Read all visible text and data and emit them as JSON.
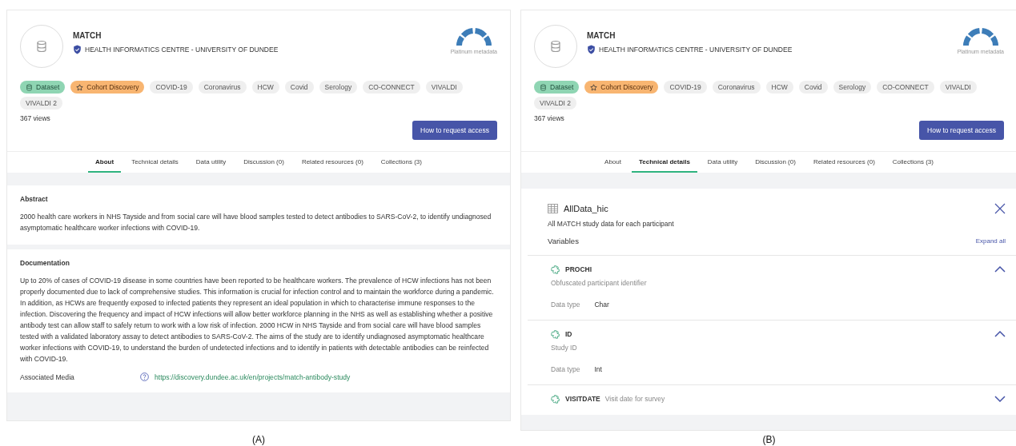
{
  "panels": [
    {
      "caption": "(A)",
      "title": "MATCH",
      "publisher": "HEALTH INFORMATICS CENTRE - UNIVERSITY OF DUNDEE",
      "metadata_badge": "Platinum metadata",
      "tags": [
        {
          "label": "Dataset",
          "kind": "dataset"
        },
        {
          "label": "Cohort Discovery",
          "kind": "cohort"
        },
        {
          "label": "COVID-19",
          "kind": "keyword"
        },
        {
          "label": "Coronavirus",
          "kind": "keyword"
        },
        {
          "label": "HCW",
          "kind": "keyword"
        },
        {
          "label": "Covid",
          "kind": "keyword"
        },
        {
          "label": "Serology",
          "kind": "keyword"
        },
        {
          "label": "CO-CONNECT",
          "kind": "keyword"
        },
        {
          "label": "VIVALDI",
          "kind": "keyword"
        },
        {
          "label": "VIVALDI 2",
          "kind": "keyword"
        }
      ],
      "views": "367 views",
      "request_button": "How to request access",
      "tabs": [
        {
          "label": "About",
          "selected": true
        },
        {
          "label": "Technical details",
          "selected": false
        },
        {
          "label": "Data utility",
          "selected": false
        },
        {
          "label": "Discussion (0)",
          "selected": false
        },
        {
          "label": "Related resources (0)",
          "selected": false
        },
        {
          "label": "Collections (3)",
          "selected": false
        }
      ],
      "content": {
        "kind": "about",
        "sections": [
          {
            "heading": "Abstract",
            "text": "2000 health care workers in NHS Tayside and from social care will have blood samples tested to detect antibodies to SARS-CoV-2, to identify undiagnosed asymptomatic healthcare worker infections with COVID-19."
          },
          {
            "heading": "Documentation",
            "text": "Up to 20% of cases of COVID-19 disease in some countries have been reported to be healthcare workers. The prevalence of HCW infections has not been properly documented due to lack of comprehensive studies. This information is crucial for infection control and to maintain the workforce during a pandemic. In addition, as HCWs are frequently exposed to infected patients they represent an ideal population in which to characterise immune responses to the infection. Discovering the frequency and impact of HCW infections will allow better workforce planning in the NHS as well as establishing whether a positive antibody test can allow staff to safely return to work with a low risk of infection. 2000 HCW in NHS Tayside and from social care will have blood samples tested with a validated laboratory assay to detect antibodies to SARS-CoV-2. The aims of the study are to identify undiagnosed asymptomatic healthcare worker infections with COVID-19, to understand the burden of undetected infections and to identify in patients with detectable antibodies can be reinfected with COVID-19.",
            "media_label": "Associated Media",
            "media_link": "https://discovery.dundee.ac.uk/en/projects/match-antibody-study"
          }
        ]
      }
    },
    {
      "caption": "(B)",
      "title": "MATCH",
      "publisher": "HEALTH INFORMATICS CENTRE - UNIVERSITY OF DUNDEE",
      "metadata_badge": "Platinum metadata",
      "tags": [
        {
          "label": "Dataset",
          "kind": "dataset"
        },
        {
          "label": "Cohort Discovery",
          "kind": "cohort"
        },
        {
          "label": "COVID-19",
          "kind": "keyword"
        },
        {
          "label": "Coronavirus",
          "kind": "keyword"
        },
        {
          "label": "HCW",
          "kind": "keyword"
        },
        {
          "label": "Covid",
          "kind": "keyword"
        },
        {
          "label": "Serology",
          "kind": "keyword"
        },
        {
          "label": "CO-CONNECT",
          "kind": "keyword"
        },
        {
          "label": "VIVALDI",
          "kind": "keyword"
        },
        {
          "label": "VIVALDI 2",
          "kind": "keyword"
        }
      ],
      "views": "367 views",
      "request_button": "How to request access",
      "tabs": [
        {
          "label": "About",
          "selected": false
        },
        {
          "label": "Technical details",
          "selected": true
        },
        {
          "label": "Data utility",
          "selected": false
        },
        {
          "label": "Discussion (0)",
          "selected": false
        },
        {
          "label": "Related resources (0)",
          "selected": false
        },
        {
          "label": "Collections (3)",
          "selected": false
        }
      ],
      "content": {
        "kind": "technical",
        "table_name": "AllData_hic",
        "table_description": "All MATCH study data for each participant",
        "variables_label": "Variables",
        "expand_all": "Expand all",
        "variables": [
          {
            "name": "PROCHI",
            "description": "Obfuscated participant identifier",
            "expanded": true,
            "data_type_label": "Data type",
            "data_type": "Char"
          },
          {
            "name": "ID",
            "description": "Study ID",
            "expanded": true,
            "data_type_label": "Data type",
            "data_type": "Int"
          },
          {
            "name": "VISITDATE",
            "description": "Visit date for survey",
            "expanded": false
          }
        ]
      }
    }
  ]
}
